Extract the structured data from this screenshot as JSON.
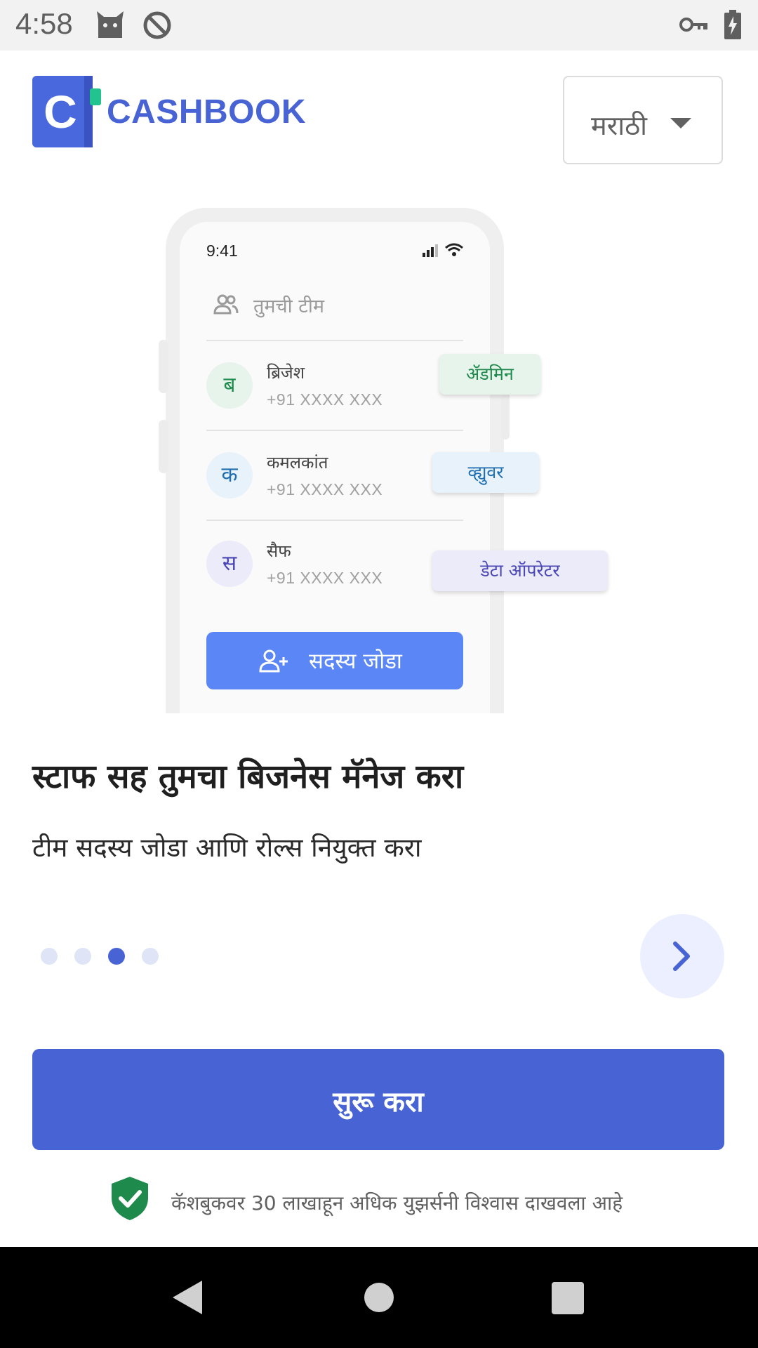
{
  "status_bar": {
    "time": "4:58",
    "icons": [
      "cat-icon",
      "no-sync-icon",
      "vpn-key-icon",
      "battery-charging-icon"
    ]
  },
  "header": {
    "brand": "CASHBOOK",
    "logo_letter": "C",
    "language": "मराठी"
  },
  "illustration": {
    "phone_time": "9:41",
    "team_label": "तुमची टीम",
    "members": [
      {
        "initial": "ब",
        "name": "ब्रिजेश",
        "phone": "+91 XXXX XXX",
        "role": "ॲडमिन"
      },
      {
        "initial": "क",
        "name": "कमलकांत",
        "phone": "+91 XXXX XXX",
        "role": "व्ह्युवर"
      },
      {
        "initial": "स",
        "name": "सैफ",
        "phone": "+91 XXXX XXX",
        "role": "डेटा ऑपरेटर"
      }
    ],
    "add_member_label": "सदस्य जोडा"
  },
  "onboarding": {
    "headline": "स्टाफ सह तुमचा बिजनेस मॅनेज करा",
    "subline": "टीम सदस्य जोडा आणि रोल्स नियुक्त करा",
    "total_pages": 4,
    "current_page": 3
  },
  "cta": {
    "label": "सुरू करा"
  },
  "trust": {
    "text": "कॅशबुकवर 30 लाखाहून अधिक युझर्सनी विश्वास दाखवला आहे"
  },
  "colors": {
    "brand": "#4863d4",
    "add_button": "#5b86f6",
    "admin_role": "#1e8a4b",
    "viewer_role": "#1f6fb0",
    "operator_role": "#4a47b5",
    "shield": "#1e8a4b"
  }
}
